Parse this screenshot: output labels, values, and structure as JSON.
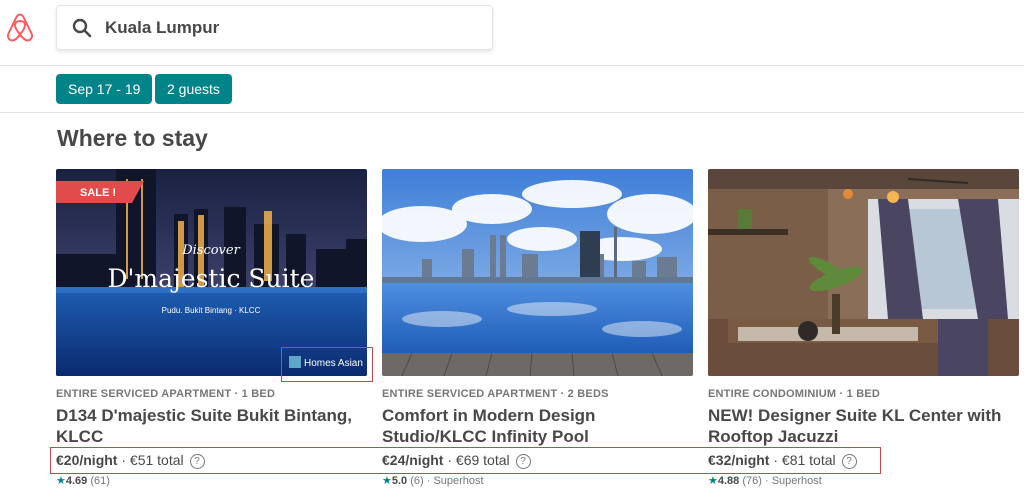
{
  "header": {
    "logo": "airbnb-logo",
    "search_value": "Kuala Lumpur",
    "search_icon": "search-icon"
  },
  "filters": {
    "dates": "Sep 17 - 19",
    "guests": "2 guests"
  },
  "section_title": "Where to stay",
  "listings": [
    {
      "kicker": "ENTIRE SERVICED APARTMENT · 1 BED",
      "title": "D134 D'majestic Suite Bukit Bintang, KLCC",
      "price_night": "€20/night",
      "price_total": " · €51 total",
      "rating": "4.69",
      "reviews": " (61)",
      "superhost": "",
      "photo_sale": "SALE !",
      "photo_discover": "Discover",
      "photo_name": "D'majestic Suite",
      "photo_location": "Pudu. Bukit Bintang · KLCC",
      "photo_badge": "Homes Asian"
    },
    {
      "kicker": "ENTIRE SERVICED APARTMENT · 2 BEDS",
      "title": "Comfort in Modern Design Studio/KLCC Infinity Pool",
      "price_night": "€24/night",
      "price_total": " · €69 total",
      "rating": "5.0",
      "reviews": " (6)",
      "superhost": " · Superhost"
    },
    {
      "kicker": "ENTIRE CONDOMINIUM · 1 BED",
      "title": "NEW! Designer Suite KL Center with Rooftop Jacuzzi",
      "price_night": "€32/night",
      "price_total": " · €81 total",
      "rating": "4.88",
      "reviews": " (76)",
      "superhost": " · Superhost"
    }
  ],
  "colors": {
    "accent": "#008489",
    "brand": "#FF5A5F",
    "highlight": "#C8474B"
  }
}
